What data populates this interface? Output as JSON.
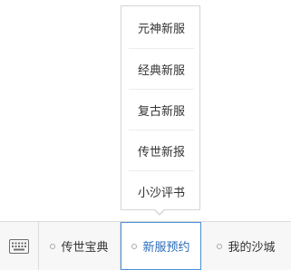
{
  "popup_menu": {
    "items": [
      {
        "label": "元神新服"
      },
      {
        "label": "经典新服"
      },
      {
        "label": "复古新服"
      },
      {
        "label": "传世新报"
      },
      {
        "label": "小沙评书"
      }
    ]
  },
  "bottom_bar": {
    "keyboard_icon": "keyboard-icon",
    "tabs": [
      {
        "label": "传世宝典",
        "active": false
      },
      {
        "label": "新服预约",
        "active": true
      },
      {
        "label": "我的沙城",
        "active": false
      }
    ]
  },
  "colors": {
    "active_border": "#4a90d9",
    "active_text": "#2a6cb8",
    "text": "#333333",
    "bar_background": "#f7f7f7"
  }
}
